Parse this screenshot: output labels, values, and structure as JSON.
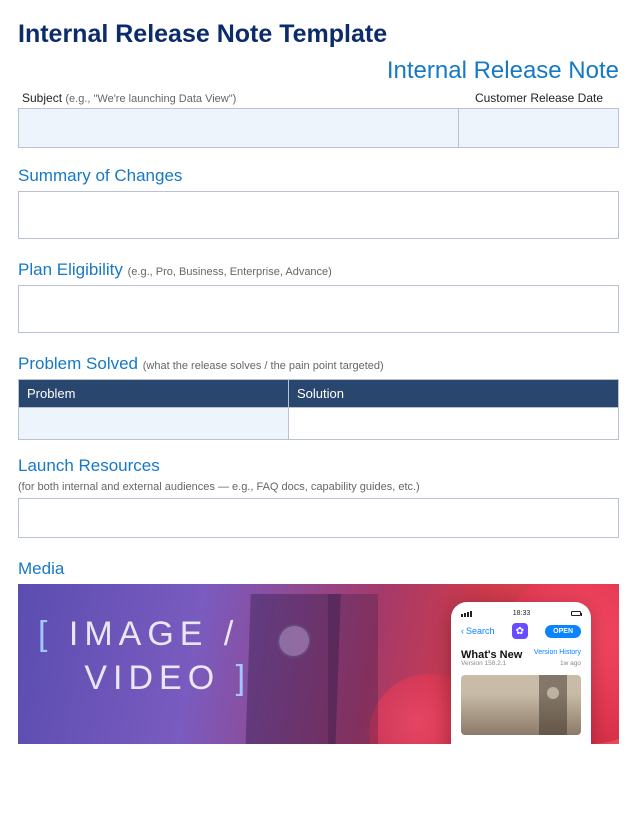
{
  "title": "Internal Release Note Template",
  "subtitle": "Internal Release Note",
  "fields": {
    "subject": {
      "label": "Subject",
      "hint": "(e.g., \"We're launching Data View\")",
      "value": ""
    },
    "release_date": {
      "label": "Customer Release Date",
      "value": ""
    }
  },
  "sections": {
    "summary": {
      "title": "Summary of Changes",
      "value": ""
    },
    "plan": {
      "title": "Plan Eligibility",
      "hint": "(e.g., Pro, Business, Enterprise, Advance)",
      "value": ""
    },
    "problem": {
      "title": "Problem Solved",
      "hint": "(what the release solves / the pain point targeted)",
      "col_problem": "Problem",
      "col_solution": "Solution",
      "rows": [
        {
          "problem": "",
          "solution": ""
        }
      ]
    },
    "launch": {
      "title": "Launch Resources",
      "sub": "(for both internal and external audiences — e.g., FAQ docs, capability guides, etc.)",
      "value": ""
    },
    "media": {
      "title": "Media",
      "banner_line1": "IMAGE /",
      "banner_line2": "VIDEO",
      "phone": {
        "time": "18:33",
        "back": "Search",
        "open": "OPEN",
        "whats_new": "What's New",
        "version_history": "Version History",
        "version": "Version 158.2.1",
        "age": "1w ago"
      }
    }
  }
}
